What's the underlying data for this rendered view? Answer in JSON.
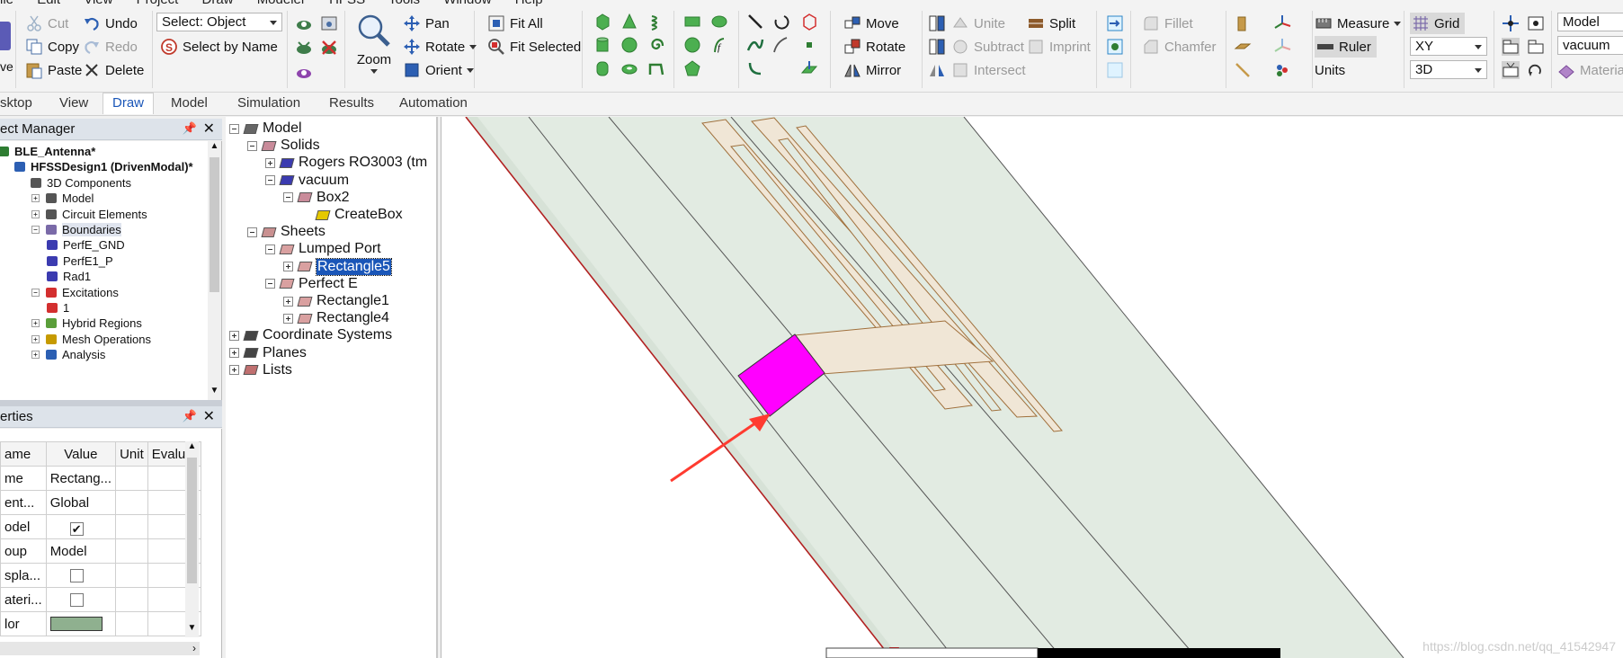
{
  "menubar": [
    "ile",
    "Edit",
    "View",
    "Project",
    "Draw",
    "Modeler",
    "HFSS",
    "Tools",
    "Window",
    "Help"
  ],
  "ribbon": {
    "save_label": "ve",
    "cut": "Cut",
    "copy": "Copy",
    "paste": "Paste",
    "undo": "Undo",
    "redo": "Redo",
    "delete": "Delete",
    "select_value": "Select: Object",
    "select_by_name": "Select by Name",
    "zoom": "Zoom",
    "pan": "Pan",
    "rotate_view": "Rotate",
    "orient": "Orient",
    "fit_all": "Fit All",
    "fit_selected": "Fit Selected",
    "move": "Move",
    "rotate": "Rotate",
    "mirror": "Mirror",
    "unite": "Unite",
    "subtract": "Subtract",
    "intersect": "Intersect",
    "split": "Split",
    "imprint": "Imprint",
    "fillet": "Fillet",
    "chamfer": "Chamfer",
    "measure": "Measure",
    "ruler": "Ruler",
    "units": "Units",
    "grid": "Grid",
    "plane_value": "XY",
    "mode_value": "3D",
    "model_value": "Model",
    "material_value": "vacuum",
    "material_label": "Materia"
  },
  "tabs": [
    "sktop",
    "View",
    "Draw",
    "Model",
    "Simulation",
    "Results",
    "Automation"
  ],
  "active_tab": "Draw",
  "project_manager": {
    "title": "ect Manager",
    "items": [
      {
        "label": "BLE_Antenna*",
        "level": 0,
        "bold": true
      },
      {
        "label": "HFSSDesign1 (DrivenModal)*",
        "level": 1,
        "bold": true
      },
      {
        "label": "3D Components",
        "level": 2
      },
      {
        "label": "Model",
        "level": 2
      },
      {
        "label": "Circuit Elements",
        "level": 2
      },
      {
        "label": "Boundaries",
        "level": 2
      },
      {
        "label": "PerfE_GND",
        "level": 3
      },
      {
        "label": "PerfE1_P",
        "level": 3
      },
      {
        "label": "Rad1",
        "level": 3
      },
      {
        "label": "Excitations",
        "level": 2
      },
      {
        "label": "1",
        "level": 3
      },
      {
        "label": "Hybrid Regions",
        "level": 2
      },
      {
        "label": "Mesh Operations",
        "level": 2
      },
      {
        "label": "Analysis",
        "level": 2
      }
    ]
  },
  "properties": {
    "title": "erties",
    "headers": [
      "ame",
      "Value",
      "Unit",
      "Evaluat"
    ],
    "rows": [
      {
        "name": "me",
        "value": "Rectang...",
        "unit": "",
        "eval": ""
      },
      {
        "name": "ent...",
        "value": "Global",
        "unit": "",
        "eval": ""
      },
      {
        "name": "odel",
        "value": "checked",
        "unit": "",
        "eval": ""
      },
      {
        "name": "oup",
        "value": "Model",
        "unit": "",
        "eval": ""
      },
      {
        "name": "spla...",
        "value": "unchecked",
        "unit": "",
        "eval": ""
      },
      {
        "name": "ateri...",
        "value": "unchecked",
        "unit": "",
        "eval": ""
      },
      {
        "name": "lor",
        "value": "color",
        "unit": "",
        "eval": ""
      }
    ],
    "color_swatch": "#8fb08f"
  },
  "model_tree": [
    {
      "label": "Model",
      "level": 0
    },
    {
      "label": "Solids",
      "level": 1
    },
    {
      "label": "Rogers RO3003 (tm",
      "level": 2
    },
    {
      "label": "vacuum",
      "level": 2
    },
    {
      "label": "Box2",
      "level": 3
    },
    {
      "label": "CreateBox",
      "level": 4
    },
    {
      "label": "Sheets",
      "level": 1
    },
    {
      "label": "Lumped Port",
      "level": 2
    },
    {
      "label": "Rectangle5",
      "level": 3,
      "selected": true
    },
    {
      "label": "Perfect E",
      "level": 2
    },
    {
      "label": "Rectangle1",
      "level": 3
    },
    {
      "label": "Rectangle4",
      "level": 3
    },
    {
      "label": "Coordinate Systems",
      "level": 0
    },
    {
      "label": "Planes",
      "level": 0
    },
    {
      "label": "Lists",
      "level": 0
    }
  ],
  "colors": {
    "accent": "#1a56b8",
    "port_magenta": "#ff00ff",
    "substrate": "#e2ebe2",
    "antenna_trace": "#f0e6d6",
    "arrow_red": "#ff3b30"
  },
  "watermark": "https://blog.csdn.net/qq_41542947"
}
